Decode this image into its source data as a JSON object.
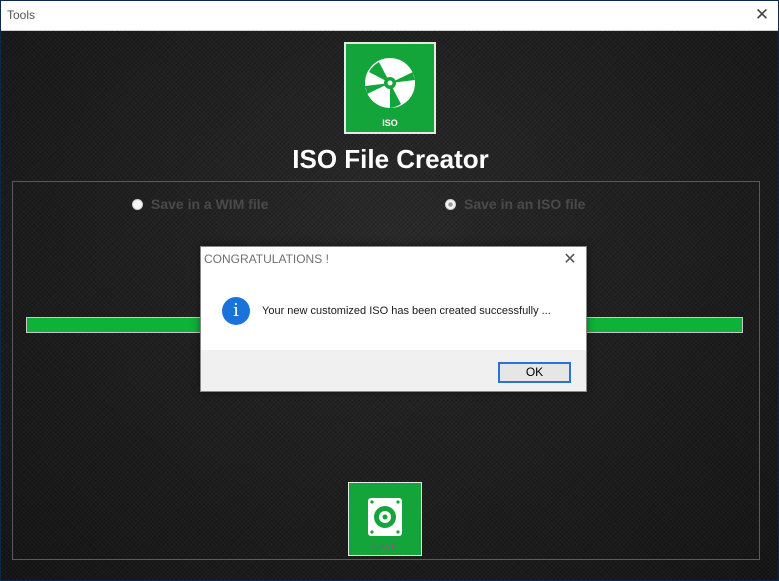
{
  "window": {
    "title": "Tools",
    "close_glyph": "✕"
  },
  "header": {
    "logo_caption": "ISO",
    "logo_icon": "disc-icon",
    "app_title": "ISO File Creator"
  },
  "options": {
    "wim_label": "Save in a WIM file",
    "iso_label": "Save in an ISO file",
    "selected": "iso"
  },
  "progress": {
    "value_percent": 100,
    "color": "#0fb239"
  },
  "save_button": {
    "label": "SAVE",
    "icon": "drive-save-icon"
  },
  "dialog": {
    "title": "CONGRATULATIONS !",
    "close_glyph": "✕",
    "icon": "info-icon",
    "icon_glyph": "i",
    "message": "Your new customized ISO has been created successfully ...",
    "ok_label": "OK"
  },
  "colors": {
    "accent_green": "#14a53a",
    "info_blue": "#1a73d9",
    "focus_blue": "#2a74d1"
  }
}
